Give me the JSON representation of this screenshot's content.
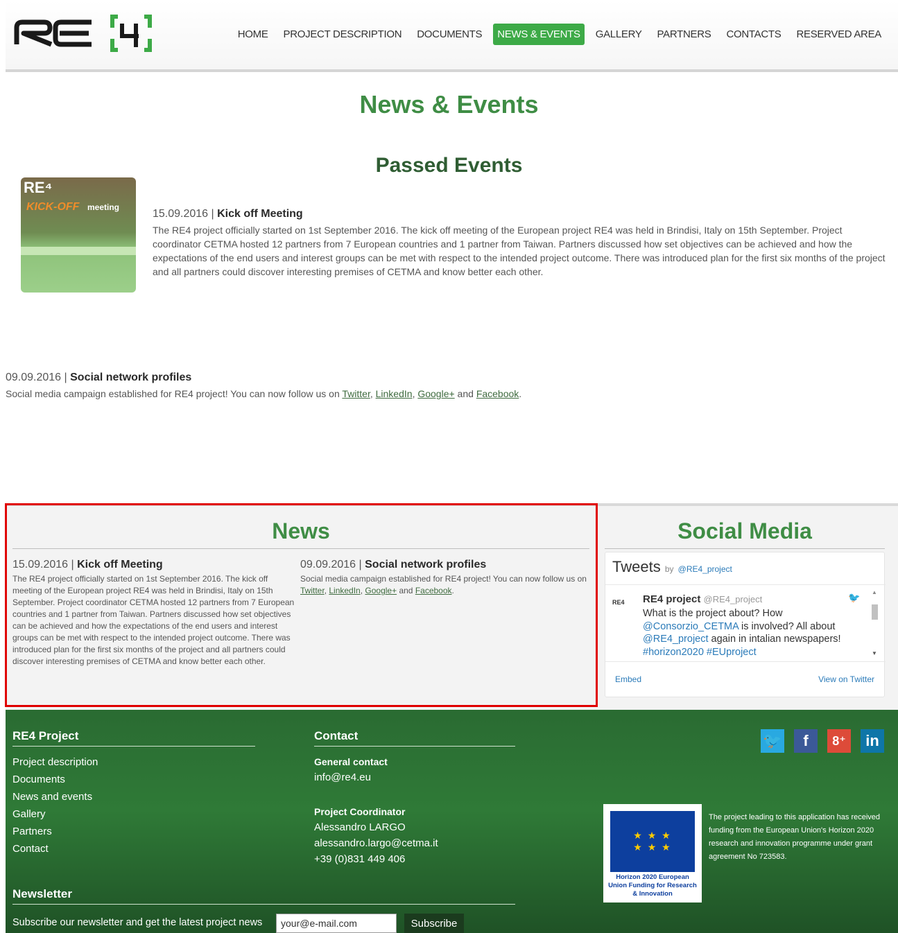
{
  "nav": {
    "items": [
      "HOME",
      "PROJECT DESCRIPTION",
      "DOCUMENTS",
      "NEWS & EVENTS",
      "GALLERY",
      "PARTNERS",
      "CONTACTS",
      "RESERVED AREA"
    ],
    "active": "NEWS & EVENTS"
  },
  "main": {
    "title": "News & Events",
    "section_title": "Passed Events",
    "thumb": {
      "logo": "RE⁴",
      "kick": "KICK-OFF",
      "meeting": "meeting"
    },
    "events": [
      {
        "date": "15.09.2016",
        "sep": " | ",
        "title": "Kick off Meeting",
        "text": "The RE4 project officially started on 1st September 2016. The kick off meeting of the European project RE4 was held in Brindisi, Italy on 15th September. Project coordinator CETMA hosted 12 partners from 7 European countries and 1 partner from Taiwan. Partners discussed how set objectives can be achieved and how the expectations of the end users and interest groups can be met with respect to the intended project outcome. There was introduced plan for the first six months of the project and all partners could discover interesting premises of CETMA and know better each other."
      },
      {
        "date": "09.09.2016",
        "sep": " | ",
        "title": "Social network profiles",
        "text_pre": "Social media campaign established for RE4 project! You can now follow us on ",
        "links": [
          "Twitter",
          "LinkedIn",
          "Google+",
          "Facebook"
        ],
        "comma": ", ",
        "and": " and ",
        "period": "."
      }
    ]
  },
  "news": {
    "title": "News"
  },
  "social": {
    "title": "Social Media",
    "widget": {
      "tweets_label": "Tweets",
      "by": "by",
      "handle": "@RE4_project",
      "avatar_text": "RE4",
      "tweet_name": "RE4 project",
      "tweet_handle": "@RE4_project",
      "tweet_line1": "What is the project about? How",
      "tweet_mention1": "@Consorzio_CETMA",
      "tweet_line2": " is involved? All about",
      "tweet_mention2": "@RE4_project",
      "tweet_line3": " again in intalian newspapers!",
      "tweet_tags": "#horizon2020 #EUproject",
      "embed": "Embed",
      "view_on_twitter": "View on Twitter"
    }
  },
  "footer": {
    "project_head": "RE4 Project",
    "links": [
      "Project description",
      "Documents",
      "News and events",
      "Gallery",
      "Partners",
      "Contact"
    ],
    "contact_head": "Contact",
    "general_label": "General contact",
    "general_email": "info@re4.eu",
    "coord_label": "Project Coordinator",
    "coord_name": "Alessandro LARGO",
    "coord_email": "alessandro.largo@cetma.it",
    "coord_phone": "+39 (0)831 449 406",
    "newsletter_head": "Newsletter",
    "newsletter_text": "Subscribe our newsletter and get the latest project news",
    "newsletter_value": "your@e-mail.com",
    "subscribe": "Subscribe",
    "eu_caption": "Horizon 2020 European Union Funding for Research & Innovation",
    "eu_text": "The project leading to this application has received funding from the European Union's Horizon 2020 research and innovation programme under grant agreement No 723583.",
    "social_icons": [
      {
        "name": "twitter",
        "glyph": "🐦",
        "color": "#29a9e1"
      },
      {
        "name": "facebook",
        "glyph": "f",
        "color": "#3b5998"
      },
      {
        "name": "google-plus",
        "glyph": "8⁺",
        "color": "#dd4b39"
      },
      {
        "name": "linkedin",
        "glyph": "in",
        "color": "#0e76a8"
      }
    ]
  }
}
